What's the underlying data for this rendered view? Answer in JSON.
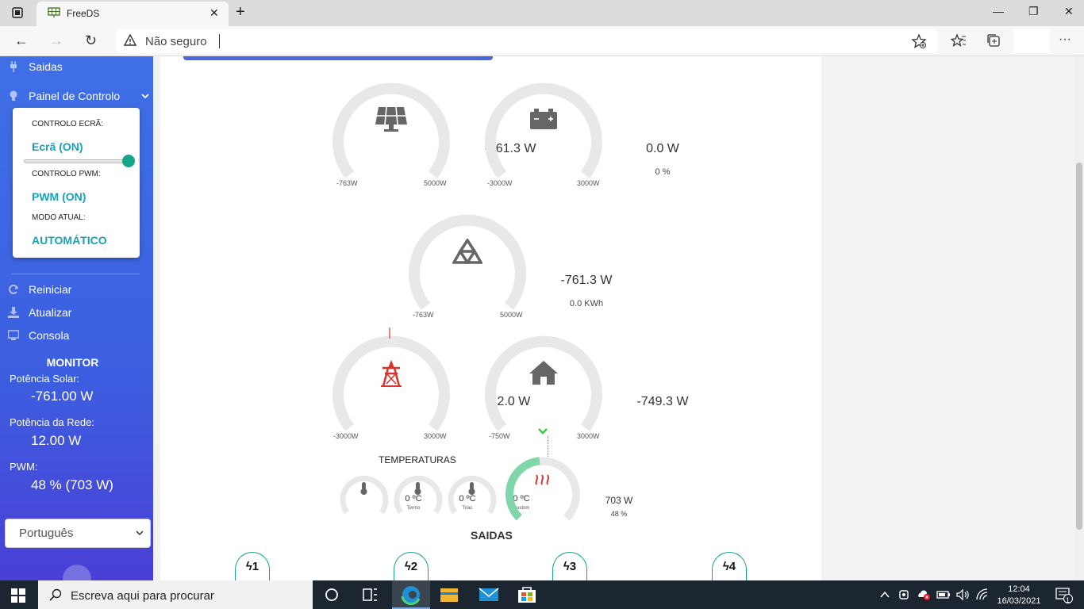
{
  "browser": {
    "tab_title": "FreeDS",
    "close_glyph": "✕",
    "new_tab_glyph": "+",
    "min_glyph": "—",
    "max_glyph": "❐",
    "winclose_glyph": "✕",
    "back_glyph": "←",
    "forward_glyph": "→",
    "reload_glyph": "↻",
    "url_status": "Não seguro",
    "more_glyph": "···"
  },
  "sidebar": {
    "items": [
      {
        "label": "Saidas"
      },
      {
        "label": "Painel de Controlo"
      },
      {
        "label": "Reiniciar"
      },
      {
        "label": "Atualizar"
      },
      {
        "label": "Consola"
      }
    ],
    "dropdown": {
      "screen_label": "CONTROLO ECRÃ:",
      "screen_value": "Ecrã (ON)",
      "pwm_label": "CONTROLO PWM:",
      "pwm_value": "PWM (ON)",
      "mode_label": "MODO ATUAL:",
      "mode_value": "AUTOMÁTICO",
      "slider_level": 1.0
    },
    "monitor": {
      "title": "MONITOR",
      "solar_label": "Potência Solar:",
      "solar_value": "-761.00 W",
      "grid_label": "Potência da Rede:",
      "grid_value": "12.00 W",
      "pwm_label": "PWM:",
      "pwm_value": "48 % (703 W)"
    },
    "language": "Português"
  },
  "gauges": {
    "solar": {
      "value": "-761.3 W",
      "min": "-763W",
      "max": "5000W",
      "icon": "solar-panel-icon"
    },
    "battery": {
      "value": "0.0 W",
      "sub": "0 %",
      "min": "-3000W",
      "max": "3000W",
      "icon": "battery-icon"
    },
    "recycle": {
      "value": "-761.3 W",
      "sub": "0.0 KWh",
      "min": "-763W",
      "max": "5000W",
      "icon": "recycle-icon"
    },
    "grid": {
      "value": "12.0 W",
      "min": "-3000W",
      "max": "3000W",
      "icon": "power-tower-icon"
    },
    "house": {
      "value": "-749.3 W",
      "min": "-750W",
      "max": "3000W",
      "icon": "house-icon"
    }
  },
  "temperatures": {
    "title": "TEMPERATURAS",
    "items": [
      {
        "value": "0 ºC",
        "label": "Termo"
      },
      {
        "value": "0 ºC",
        "label": "Triac"
      },
      {
        "value": "0 ºC",
        "label": "Custom"
      }
    ]
  },
  "heater": {
    "value": "703 W",
    "percent": "48 %",
    "level": 0.48
  },
  "outputs": {
    "title": "SAIDAS",
    "items": [
      {
        "label": "1"
      },
      {
        "label": "2"
      },
      {
        "label": "3"
      },
      {
        "label": "4"
      }
    ]
  },
  "taskbar": {
    "search_placeholder": "Escreva aqui para procurar",
    "time": "12:04",
    "date": "16/03/2021",
    "notif_count": "1"
  },
  "colors": {
    "sidebar": "#3f6fe6",
    "accent": "#17a2b8",
    "gauge_track": "#e8e8e8",
    "heater_fill": "#7fd6a8",
    "grid_red": "#d9342b"
  }
}
